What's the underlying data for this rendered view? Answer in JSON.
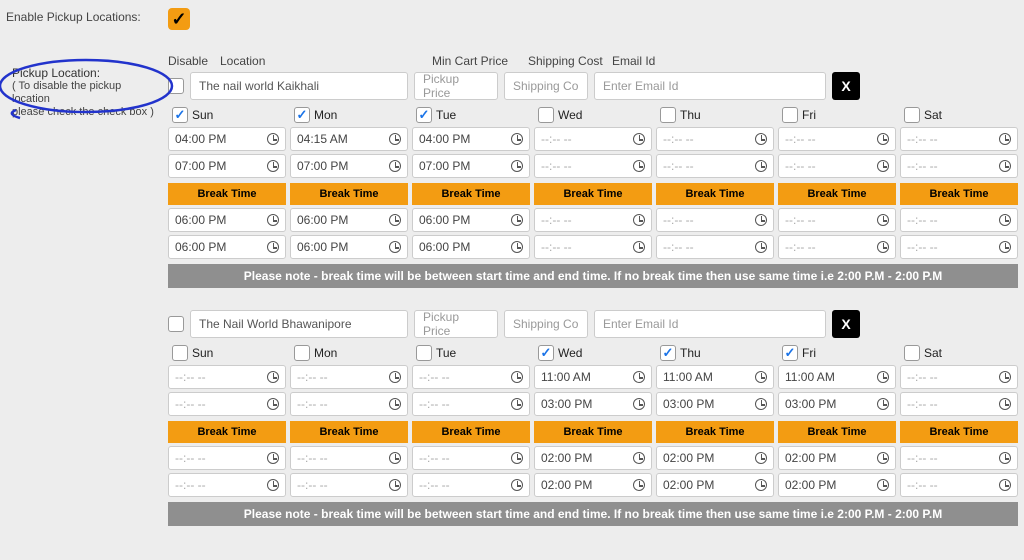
{
  "enable_label": "Enable Pickup Locations:",
  "annotation": {
    "title": "Pickup Location:",
    "sub1": "( To disable the pickup location",
    "sub2": "please check the check box )"
  },
  "headers": {
    "disable": "Disable",
    "location": "Location",
    "min": "Min Cart Price",
    "ship": "Shipping Cost",
    "email": "Email Id"
  },
  "placeholders": {
    "min": "Pickup Price",
    "ship": "Shipping Co",
    "email": "Enter Email Id",
    "empty_time": "--:-- --"
  },
  "delete_label": "X",
  "break_time_label": "Break Time",
  "note_text": "Please note - break time will be between start time and end time. If no break time then use same time i.e 2:00 P.M - 2:00 P.M",
  "day_labels": [
    "Sun",
    "Mon",
    "Tue",
    "Wed",
    "Thu",
    "Fri",
    "Sat"
  ],
  "locations": [
    {
      "name": "The nail world Kaikhali",
      "days": [
        {
          "checked": true,
          "t1": "04:00 PM",
          "t2": "07:00 PM",
          "b1": "06:00 PM",
          "b2": "06:00 PM"
        },
        {
          "checked": true,
          "t1": "04:15 AM",
          "t2": "07:00 PM",
          "b1": "06:00 PM",
          "b2": "06:00 PM"
        },
        {
          "checked": true,
          "t1": "04:00 PM",
          "t2": "07:00 PM",
          "b1": "06:00 PM",
          "b2": "06:00 PM"
        },
        {
          "checked": false,
          "t1": "",
          "t2": "",
          "b1": "",
          "b2": ""
        },
        {
          "checked": false,
          "t1": "",
          "t2": "",
          "b1": "",
          "b2": ""
        },
        {
          "checked": false,
          "t1": "",
          "t2": "",
          "b1": "",
          "b2": ""
        },
        {
          "checked": false,
          "t1": "",
          "t2": "",
          "b1": "",
          "b2": ""
        }
      ]
    },
    {
      "name": "The Nail World Bhawanipore",
      "days": [
        {
          "checked": false,
          "t1": "",
          "t2": "",
          "b1": "",
          "b2": ""
        },
        {
          "checked": false,
          "t1": "",
          "t2": "",
          "b1": "",
          "b2": ""
        },
        {
          "checked": false,
          "t1": "",
          "t2": "",
          "b1": "",
          "b2": ""
        },
        {
          "checked": true,
          "t1": "11:00 AM",
          "t2": "03:00 PM",
          "b1": "02:00 PM",
          "b2": "02:00 PM"
        },
        {
          "checked": true,
          "t1": "11:00 AM",
          "t2": "03:00 PM",
          "b1": "02:00 PM",
          "b2": "02:00 PM"
        },
        {
          "checked": true,
          "t1": "11:00 AM",
          "t2": "03:00 PM",
          "b1": "02:00 PM",
          "b2": "02:00 PM"
        },
        {
          "checked": false,
          "t1": "",
          "t2": "",
          "b1": "",
          "b2": ""
        }
      ]
    }
  ]
}
